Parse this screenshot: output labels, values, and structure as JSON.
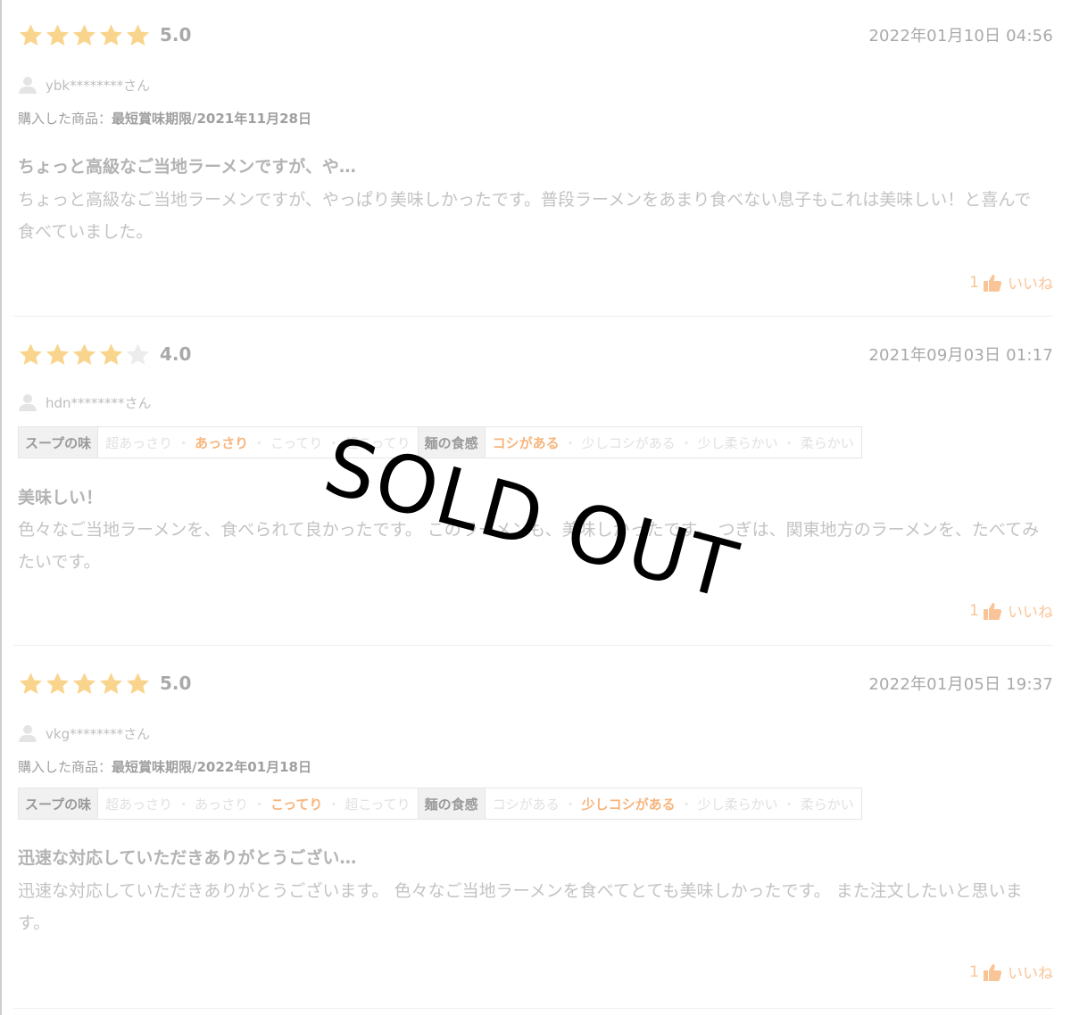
{
  "colors": {
    "star_on": "#f9d48c",
    "star_off": "#ececec",
    "accent": "#f7b57d",
    "like": "#f9c598"
  },
  "reviews": [
    {
      "stars": 5,
      "score": "5.0",
      "date": "2022年01月10日 04:56",
      "user": "ybk********さん",
      "purchase_label": "購入した商品：",
      "purchase_value": "最短賞味期限/2021年11月28日",
      "title": "ちょっと高級なご当地ラーメンですが、や…",
      "body": "ちょっと高級なご当地ラーメンですが、やっぱり美味しかったです。普段ラーメンをあまり食べない息子もこれは美味しい！と喜んで食べていました。",
      "like_count": "1",
      "like_label": "いいね"
    },
    {
      "stars": 4,
      "score": "4.0",
      "date": "2021年09月03日 01:17",
      "user": "hdn********さん",
      "attrs": [
        {
          "head": "スープの味",
          "options": [
            "超あっさり",
            "あっさり",
            "こってり",
            "超こってり"
          ],
          "selected": 1
        },
        {
          "head": "麺の食感",
          "options": [
            "コシがある",
            "少しコシがある",
            "少し柔らかい",
            "柔らかい"
          ],
          "selected": 0
        }
      ],
      "title": "美味しい！",
      "body": "色々なご当地ラーメンを、食べられて良かったです。 このラーメンも、美味しかったです。 つぎは、関東地方のラーメンを、たべてみたいです。",
      "like_count": "1",
      "like_label": "いいね"
    },
    {
      "stars": 5,
      "score": "5.0",
      "date": "2022年01月05日 19:37",
      "user": "vkg********さん",
      "purchase_label": "購入した商品：",
      "purchase_value": "最短賞味期限/2022年01月18日",
      "attrs": [
        {
          "head": "スープの味",
          "options": [
            "超あっさり",
            "あっさり",
            "こってり",
            "超こってり"
          ],
          "selected": 2
        },
        {
          "head": "麺の食感",
          "options": [
            "コシがある",
            "少しコシがある",
            "少し柔らかい",
            "柔らかい"
          ],
          "selected": 1
        }
      ],
      "title": "迅速な対応していただきありがとうござい…",
      "body": "迅速な対応していただきありがとうございます。 色々なご当地ラーメンを食べてとても美味しかったです。 また注文したいと思います。",
      "like_count": "1",
      "like_label": "いいね"
    }
  ],
  "overlay": {
    "text": "SOLD OUT"
  }
}
